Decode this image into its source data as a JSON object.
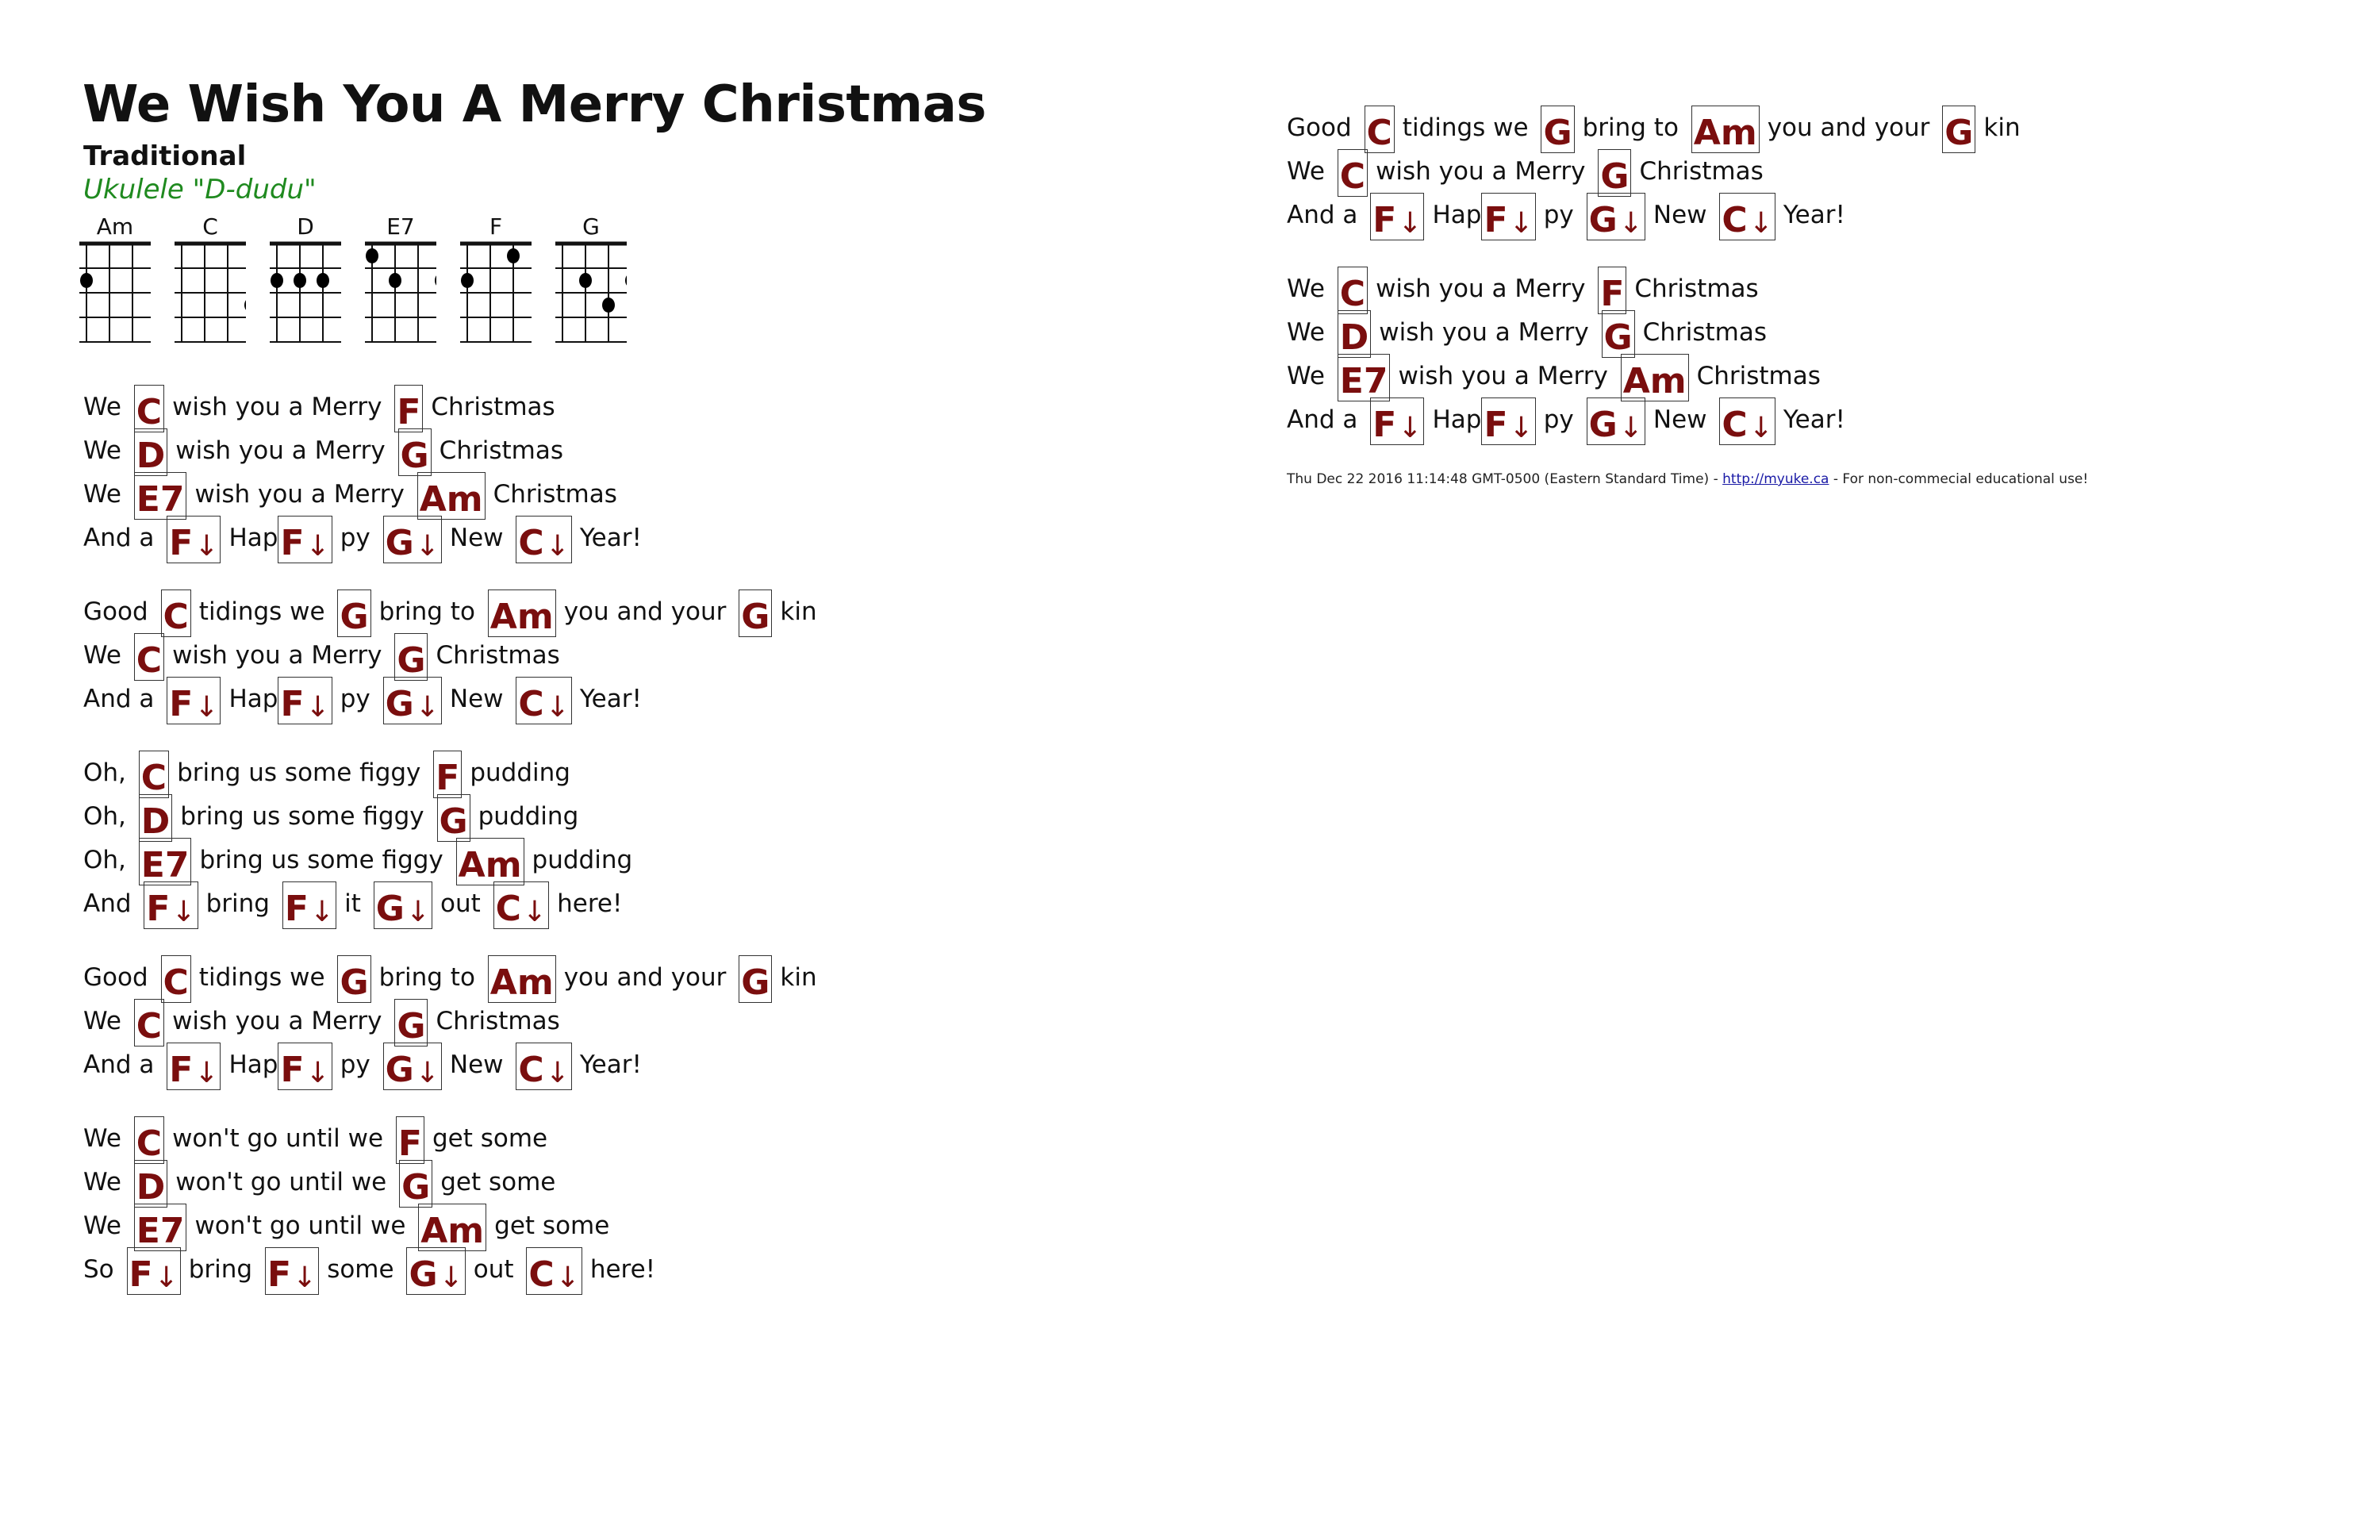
{
  "song": {
    "title": "We Wish You A Merry Christmas",
    "artist": "Traditional",
    "instrument": "Ukulele \"D-dudu\""
  },
  "colors": {
    "chord": "#7a0e0e",
    "instrument": "#1f8a1f",
    "link": "#1a1aa6"
  },
  "chord_diagrams": [
    {
      "name": "Am",
      "dots": [
        {
          "string": 1,
          "fret": 2
        }
      ]
    },
    {
      "name": "C",
      "dots": [
        {
          "string": 4,
          "fret": 3
        }
      ]
    },
    {
      "name": "D",
      "dots": [
        {
          "string": 1,
          "fret": 2
        },
        {
          "string": 2,
          "fret": 2
        },
        {
          "string": 3,
          "fret": 2
        }
      ]
    },
    {
      "name": "E7",
      "dots": [
        {
          "string": 1,
          "fret": 1
        },
        {
          "string": 2,
          "fret": 2
        },
        {
          "string": 4,
          "fret": 2
        }
      ]
    },
    {
      "name": "F",
      "dots": [
        {
          "string": 3,
          "fret": 1
        },
        {
          "string": 1,
          "fret": 2
        }
      ]
    },
    {
      "name": "G",
      "dots": [
        {
          "string": 2,
          "fret": 2
        },
        {
          "string": 4,
          "fret": 2
        },
        {
          "string": 3,
          "fret": 3
        }
      ]
    }
  ],
  "strum_symbol": "↓",
  "left_column": [
    [
      [
        [
          "We "
        ],
        [
          "C"
        ],
        [
          "wish you a Merry "
        ],
        [
          "F"
        ],
        [
          "Christmas"
        ]
      ],
      [
        [
          "We "
        ],
        [
          "D"
        ],
        [
          "wish you a Merry "
        ],
        [
          "G"
        ],
        [
          "Christmas"
        ]
      ],
      [
        [
          "We "
        ],
        [
          "E7"
        ],
        [
          "wish you a Merry "
        ],
        [
          "Am"
        ],
        [
          "Christmas"
        ]
      ],
      [
        [
          "And a "
        ],
        [
          "F",
          "↓"
        ],
        [
          "Hap"
        ],
        [
          "F",
          "↓"
        ],
        [
          "py "
        ],
        [
          "G",
          "↓"
        ],
        [
          "New "
        ],
        [
          "C",
          "↓"
        ],
        [
          "Year!"
        ]
      ]
    ],
    [
      [
        [
          "Good "
        ],
        [
          "C"
        ],
        [
          "tidings we "
        ],
        [
          "G"
        ],
        [
          "bring to "
        ],
        [
          "Am"
        ],
        [
          "you and your "
        ],
        [
          "G"
        ],
        [
          "kin"
        ]
      ],
      [
        [
          "We "
        ],
        [
          "C"
        ],
        [
          "wish you a Merry "
        ],
        [
          "G"
        ],
        [
          "Christmas"
        ]
      ],
      [
        [
          "And a "
        ],
        [
          "F",
          "↓"
        ],
        [
          "Hap"
        ],
        [
          "F",
          "↓"
        ],
        [
          "py "
        ],
        [
          "G",
          "↓"
        ],
        [
          "New "
        ],
        [
          "C",
          "↓"
        ],
        [
          "Year!"
        ]
      ]
    ],
    [
      [
        [
          "Oh, "
        ],
        [
          "C"
        ],
        [
          "bring us some figgy "
        ],
        [
          "F"
        ],
        [
          "pudding"
        ]
      ],
      [
        [
          "Oh, "
        ],
        [
          "D"
        ],
        [
          "bring us some figgy "
        ],
        [
          "G"
        ],
        [
          "pudding"
        ]
      ],
      [
        [
          "Oh, "
        ],
        [
          "E7"
        ],
        [
          "bring us some figgy "
        ],
        [
          "Am"
        ],
        [
          "pudding"
        ]
      ],
      [
        [
          "And "
        ],
        [
          "F",
          "↓"
        ],
        [
          "bring "
        ],
        [
          "F",
          "↓"
        ],
        [
          "it "
        ],
        [
          "G",
          "↓"
        ],
        [
          "out "
        ],
        [
          "C",
          "↓"
        ],
        [
          "here!"
        ]
      ]
    ],
    [
      [
        [
          "Good "
        ],
        [
          "C"
        ],
        [
          "tidings we "
        ],
        [
          "G"
        ],
        [
          "bring to "
        ],
        [
          "Am"
        ],
        [
          "you and your "
        ],
        [
          "G"
        ],
        [
          "kin"
        ]
      ],
      [
        [
          "We "
        ],
        [
          "C"
        ],
        [
          "wish you a Merry "
        ],
        [
          "G"
        ],
        [
          "Christmas"
        ]
      ],
      [
        [
          "And a "
        ],
        [
          "F",
          "↓"
        ],
        [
          "Hap"
        ],
        [
          "F",
          "↓"
        ],
        [
          "py "
        ],
        [
          "G",
          "↓"
        ],
        [
          "New "
        ],
        [
          "C",
          "↓"
        ],
        [
          "Year!"
        ]
      ]
    ],
    [
      [
        [
          "We "
        ],
        [
          "C"
        ],
        [
          "won't go until we "
        ],
        [
          "F"
        ],
        [
          "get some"
        ]
      ],
      [
        [
          "We "
        ],
        [
          "D"
        ],
        [
          "won't go until we "
        ],
        [
          "G"
        ],
        [
          "get some"
        ]
      ],
      [
        [
          "We "
        ],
        [
          "E7"
        ],
        [
          "won't go until we "
        ],
        [
          "Am"
        ],
        [
          "get some"
        ]
      ],
      [
        [
          "So "
        ],
        [
          "F",
          "↓"
        ],
        [
          "bring "
        ],
        [
          "F",
          "↓"
        ],
        [
          "some "
        ],
        [
          "G",
          "↓"
        ],
        [
          "out "
        ],
        [
          "C",
          "↓"
        ],
        [
          "here!"
        ]
      ]
    ]
  ],
  "right_column": [
    [
      [
        [
          "Good "
        ],
        [
          "C"
        ],
        [
          "tidings we "
        ],
        [
          "G"
        ],
        [
          "bring to "
        ],
        [
          "Am"
        ],
        [
          "you and your "
        ],
        [
          "G"
        ],
        [
          "kin"
        ]
      ],
      [
        [
          "We "
        ],
        [
          "C"
        ],
        [
          "wish you a Merry "
        ],
        [
          "G"
        ],
        [
          "Christmas"
        ]
      ],
      [
        [
          "And a "
        ],
        [
          "F",
          "↓"
        ],
        [
          "Hap"
        ],
        [
          "F",
          "↓"
        ],
        [
          "py "
        ],
        [
          "G",
          "↓"
        ],
        [
          "New "
        ],
        [
          "C",
          "↓"
        ],
        [
          "Year!"
        ]
      ]
    ],
    [
      [
        [
          "We "
        ],
        [
          "C"
        ],
        [
          "wish you a Merry "
        ],
        [
          "F"
        ],
        [
          "Christmas"
        ]
      ],
      [
        [
          "We "
        ],
        [
          "D"
        ],
        [
          "wish you a Merry "
        ],
        [
          "G"
        ],
        [
          "Christmas"
        ]
      ],
      [
        [
          "We "
        ],
        [
          "E7"
        ],
        [
          "wish you a Merry "
        ],
        [
          "Am"
        ],
        [
          "Christmas"
        ]
      ],
      [
        [
          "And a "
        ],
        [
          "F",
          "↓"
        ],
        [
          "Hap"
        ],
        [
          "F",
          "↓"
        ],
        [
          "py "
        ],
        [
          "G",
          "↓"
        ],
        [
          "New "
        ],
        [
          "C",
          "↓"
        ],
        [
          "Year!"
        ]
      ]
    ]
  ],
  "footer": {
    "timestamp": "Thu Dec 22 2016 11:14:48 GMT-0500 (Eastern Standard Time) - ",
    "link_text": "http://myuke.ca",
    "notice": " - For non-commecial educational use!"
  }
}
